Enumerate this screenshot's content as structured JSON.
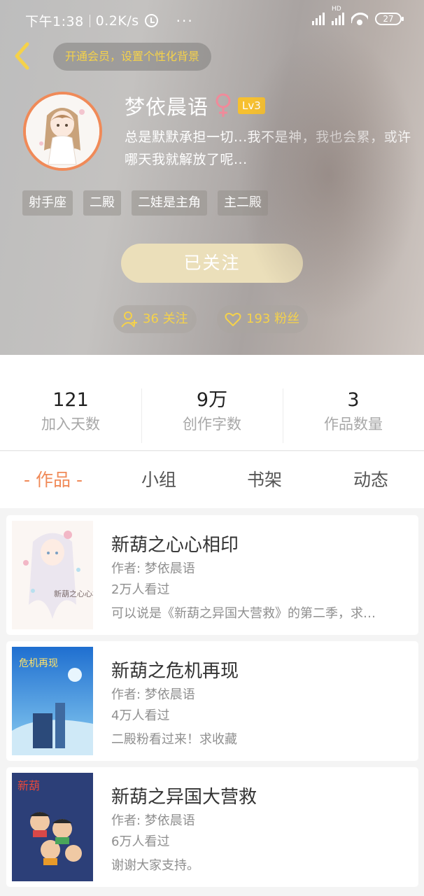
{
  "status_bar": {
    "time": "下午1:38",
    "speed": "0.2K/s",
    "more": "···",
    "hd": "HD",
    "battery": "27"
  },
  "header": {
    "vip_hint": "开通会员，设置个性化背景",
    "nickname": "梦依晨语",
    "gender_symbol": "♀",
    "level": "Lv3",
    "signature": "总是默默承担一切...我不是神，我也会累，或许哪天我就解放了呢...",
    "tags": [
      "射手座",
      "二殿",
      "二娃是主角",
      "主二殿"
    ],
    "follow_button": "已关注",
    "following_label": "36 关注",
    "fans_label": "193 粉丝"
  },
  "stats": [
    {
      "value": "121",
      "label": "加入天数"
    },
    {
      "value": "9万",
      "label": "创作字数"
    },
    {
      "value": "3",
      "label": "作品数量"
    }
  ],
  "tabs": [
    "- 作品 -",
    "小组",
    "书架",
    "动态"
  ],
  "works": [
    {
      "title": "新葫之心心相印",
      "author": "作者: 梦依晨语",
      "views": "2万人看过",
      "desc": "可以说是《新葫之异国大营救》的第二季，求…",
      "cover_text": "新葫之心心相印"
    },
    {
      "title": "新葫之危机再现",
      "author": "作者: 梦依晨语",
      "views": "4万人看过",
      "desc": "二殿粉看过来！求收藏",
      "cover_text": "危机再现"
    },
    {
      "title": "新葫之异国大营救",
      "author": "作者: 梦依晨语",
      "views": "6万人看过",
      "desc": "谢谢大家支持。",
      "cover_text": "新葫"
    }
  ],
  "colors": {
    "accent": "#f08a58",
    "gold": "#f5d24a",
    "level_badge": "#f6c030",
    "follow_button": "#ebdfba"
  }
}
